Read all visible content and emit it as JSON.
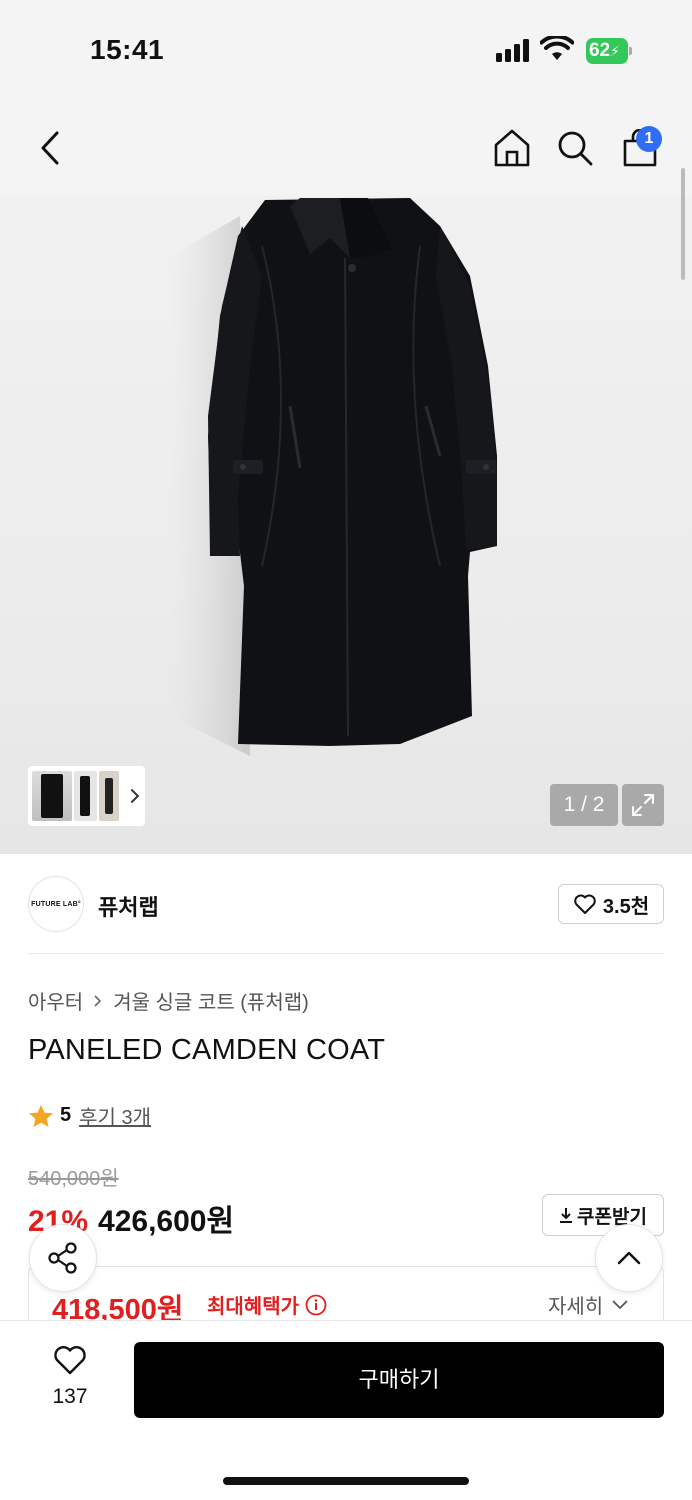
{
  "status_bar": {
    "time": "15:41",
    "battery": "62"
  },
  "header": {
    "cart_count": "1"
  },
  "gallery": {
    "counter": "1 / 2"
  },
  "brand": {
    "logo_text": "FUTURE LAB°",
    "name": "퓨처랩",
    "likes": "3.5천"
  },
  "product": {
    "breadcrumb": [
      "아우터",
      "겨울 싱글 코트 (퓨처랩)"
    ],
    "title": "PANELED CAMDEN COAT",
    "rating": "5",
    "reviews": "후기 3개",
    "original_price": "540,000원",
    "discount": "21%",
    "price": "426,600원",
    "coupon_label": "쿠폰받기",
    "benefit_price": "418,500원",
    "benefit_label": "최대혜택가",
    "detail_label": "자세히"
  },
  "bottom_bar": {
    "wish_count": "137",
    "buy_label": "구매하기"
  },
  "colors": {
    "accent_red": "#e02020",
    "badge_blue": "#2f6df6",
    "rating_star": "#f5a623"
  }
}
